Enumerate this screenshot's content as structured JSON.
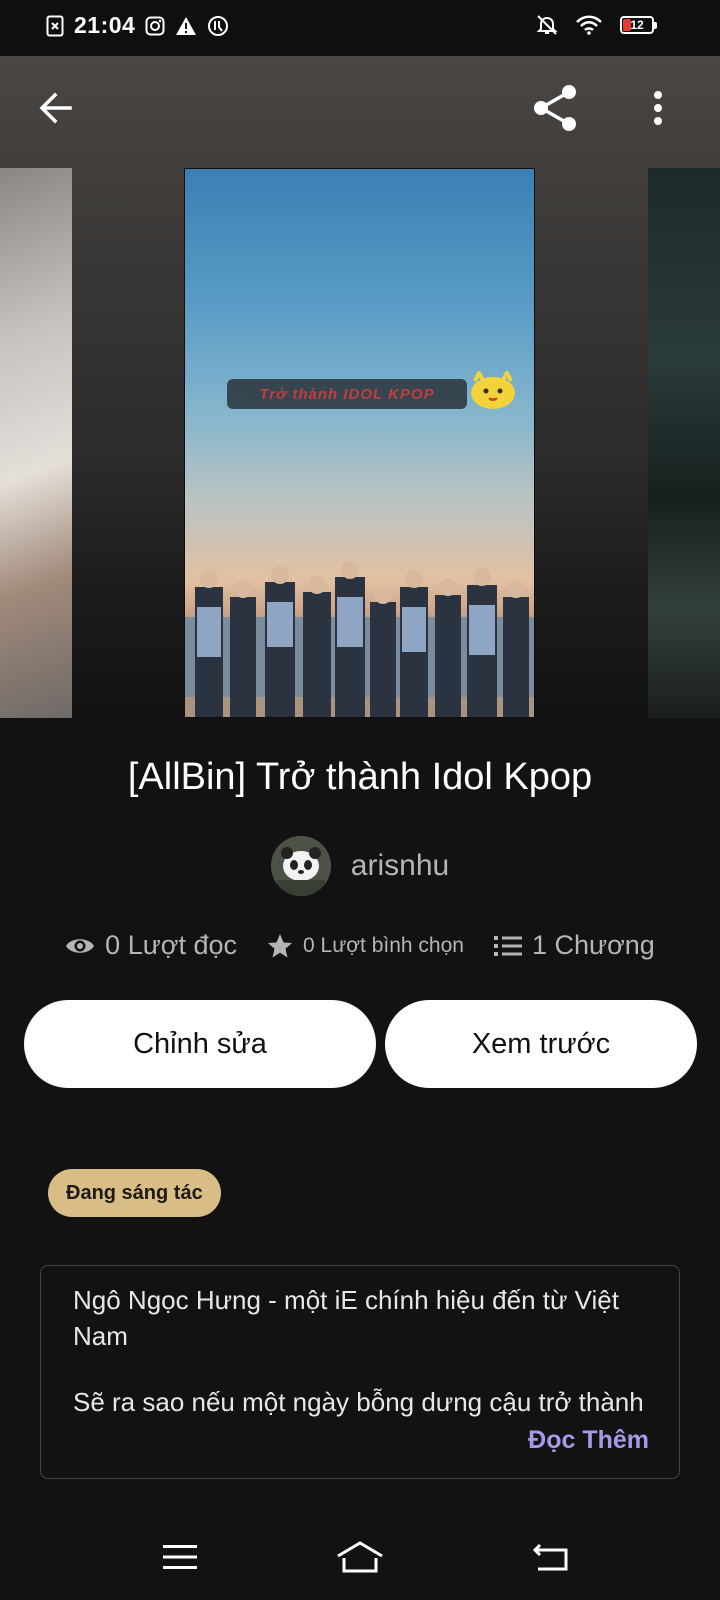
{
  "status_bar": {
    "time": "21:04",
    "battery": "12",
    "icons": [
      "sim-off-icon",
      "instagram-icon",
      "warning-icon",
      "data-saver-icon",
      "mute-icon",
      "wifi-icon",
      "battery-icon"
    ],
    "battery_color": "#e53935"
  },
  "header": {
    "back_icon": "arrow-left-icon",
    "share_icon": "share-icon",
    "more_icon": "more-vertical-icon"
  },
  "cover": {
    "title_overlay": "Trở thành IDOL KPOP"
  },
  "story": {
    "title": "[AllBin] Trở thành Idol Kpop",
    "author": "arisnhu"
  },
  "stats": {
    "reads": "0 Lượt đọc",
    "votes": "0 Lượt bình chọn",
    "chapters": "1 Chương"
  },
  "actions": {
    "edit_label": "Chỉnh sửa",
    "preview_label": "Xem trước"
  },
  "status_badge": "Đang sáng tác",
  "description": {
    "line1": "Ngô Ngọc Hưng - một iE chính hiệu đến từ Việt Nam",
    "line2": "Sẽ ra sao nếu một ngày bỗng dưng cậu trở thành",
    "read_more": "Đọc Thêm"
  },
  "colors": {
    "background": "#121212",
    "badge": "#d9bd86",
    "read_more": "#a899e6"
  },
  "nav_bar": {
    "icons": [
      "menu-icon",
      "home-icon",
      "back-icon"
    ]
  }
}
